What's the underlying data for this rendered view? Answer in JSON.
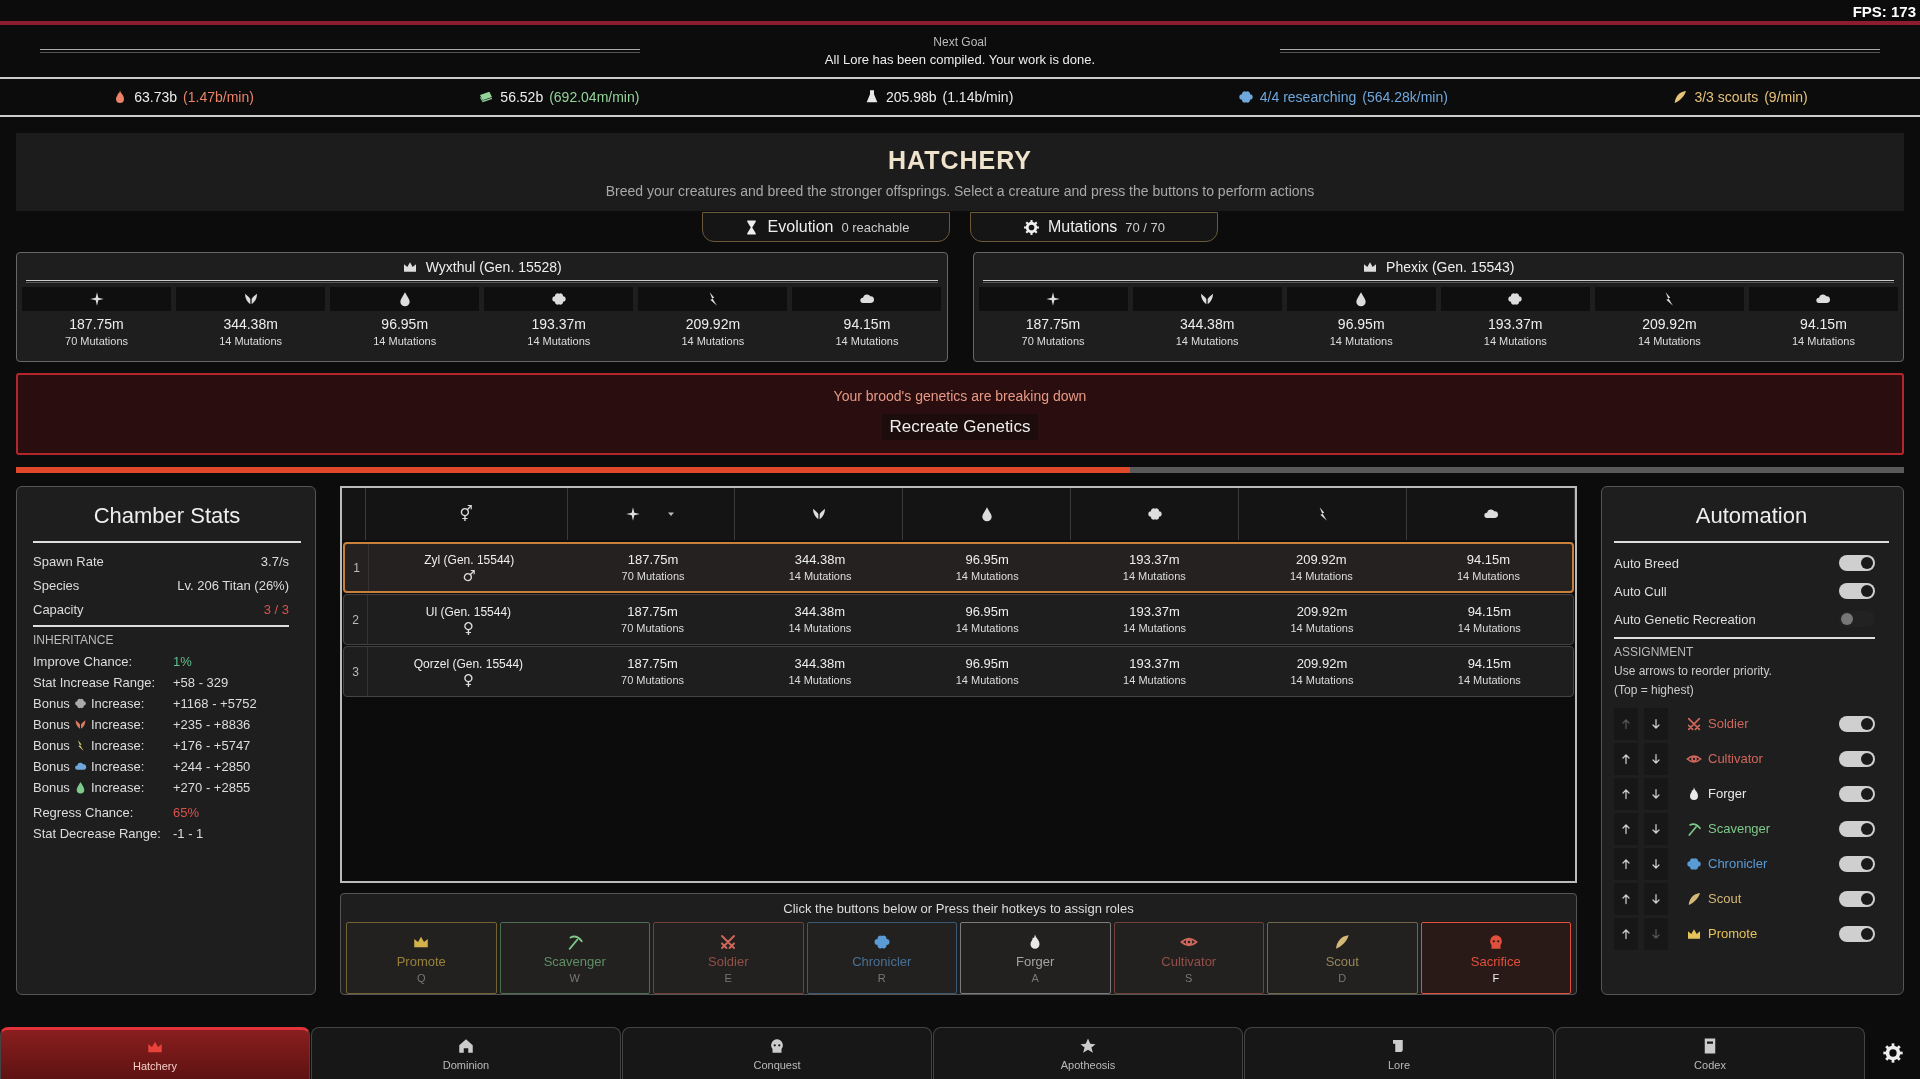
{
  "fps": "FPS: 173",
  "next_goal": {
    "title": "Next Goal",
    "message": "All Lore has been compiled. Your work is done."
  },
  "resources": [
    {
      "value": "63.73b",
      "rate": "(1.47b/min)",
      "color": "#e8836a",
      "tinted": false
    },
    {
      "value": "56.52b",
      "rate": "(692.04m/min)",
      "color": "#93d49a",
      "tinted": false
    },
    {
      "value": "205.98b",
      "rate": "(1.14b/min)",
      "color": "#e8e8e8",
      "tinted": false
    },
    {
      "value": "4/4 researching",
      "rate": "(564.28k/min)",
      "color": "#6fa8dc",
      "tinted": true
    },
    {
      "value": "3/3 scouts",
      "rate": "(9/min)",
      "color": "#e6c27a",
      "tinted": true
    }
  ],
  "hatchery": {
    "title": "HATCHERY",
    "subtitle": "Breed your creatures and breed the stronger offsprings. Select a creature and press the buttons to perform actions",
    "tabs": [
      {
        "kind": "evolution",
        "label": "Evolution",
        "count": "0 reachable"
      },
      {
        "kind": "mutations",
        "label": "Mutations",
        "count": "70 / 70"
      }
    ]
  },
  "parents": [
    {
      "name": "Wyxthul (Gen. 15528)",
      "stats": [
        {
          "value": "187.75m",
          "mutations": "70 Mutations"
        },
        {
          "value": "344.38m",
          "mutations": "14 Mutations"
        },
        {
          "value": "96.95m",
          "mutations": "14 Mutations"
        },
        {
          "value": "193.37m",
          "mutations": "14 Mutations"
        },
        {
          "value": "209.92m",
          "mutations": "14 Mutations"
        },
        {
          "value": "94.15m",
          "mutations": "14 Mutations"
        }
      ]
    },
    {
      "name": "Phexix (Gen. 15543)",
      "stats": [
        {
          "value": "187.75m",
          "mutations": "70 Mutations"
        },
        {
          "value": "344.38m",
          "mutations": "14 Mutations"
        },
        {
          "value": "96.95m",
          "mutations": "14 Mutations"
        },
        {
          "value": "193.37m",
          "mutations": "14 Mutations"
        },
        {
          "value": "209.92m",
          "mutations": "14 Mutations"
        },
        {
          "value": "94.15m",
          "mutations": "14 Mutations"
        }
      ]
    }
  ],
  "warning": {
    "message": "Your brood's genetics are breaking down",
    "button": "Recreate Genetics"
  },
  "brood_progress": {
    "level": 0.59
  },
  "chamber_stats": {
    "title": "Chamber Stats",
    "rows": [
      {
        "label": "Spawn Rate",
        "value": "3.7/s"
      },
      {
        "label": "Species",
        "value": "Lv. 206 Titan (26%)"
      },
      {
        "label": "Capacity",
        "value": "3 / 3",
        "color": "#d9534f"
      }
    ],
    "section": "INHERITANCE",
    "inheritance": [
      {
        "kind": "plain",
        "label": "Improve Chance:",
        "value": "1%",
        "color": "#5fbf8f"
      },
      {
        "kind": "plain",
        "label": "Stat Increase Range:",
        "value": "+58 - 329"
      },
      {
        "kind": "bonus",
        "before": "Bonus",
        "after": "Increase:",
        "value": "+1168 - +5752"
      },
      {
        "kind": "bonus",
        "before": "Bonus",
        "after": "Increase:",
        "value": "+235 - +8836"
      },
      {
        "kind": "bonus",
        "before": "Bonus",
        "after": "Increase:",
        "value": "+176 - +5747"
      },
      {
        "kind": "bonus",
        "before": "Bonus",
        "after": "Increase:",
        "value": "+244 - +2850"
      },
      {
        "kind": "bonus",
        "before": "Bonus",
        "after": "Increase:",
        "value": "+270 - +2855"
      },
      {
        "kind": "plain",
        "label": "Regress Chance:",
        "value": "65%",
        "color": "#d9534f"
      },
      {
        "kind": "plain",
        "label": "Stat Decrease Range:",
        "value": "-1 - 1"
      }
    ]
  },
  "table": {
    "columns": [
      {
        "text": "⚥"
      },
      {
        "sorted": true
      },
      {
        "sorted": false
      },
      {
        "sorted": false
      },
      {
        "sorted": false
      },
      {
        "sorted": false
      },
      {
        "sorted": false
      }
    ],
    "rows": [
      {
        "index": "1",
        "name": "Zyl (Gen. 15544)",
        "sex": "♂",
        "selected": true,
        "stats": [
          {
            "value": "187.75m",
            "mutations": "70 Mutations"
          },
          {
            "value": "344.38m",
            "mutations": "14 Mutations"
          },
          {
            "value": "96.95m",
            "mutations": "14 Mutations"
          },
          {
            "value": "193.37m",
            "mutations": "14 Mutations"
          },
          {
            "value": "209.92m",
            "mutations": "14 Mutations"
          },
          {
            "value": "94.15m",
            "mutations": "14 Mutations"
          }
        ]
      },
      {
        "index": "2",
        "name": "Ul (Gen. 15544)",
        "sex": "♀",
        "selected": false,
        "stats": [
          {
            "value": "187.75m",
            "mutations": "70 Mutations"
          },
          {
            "value": "344.38m",
            "mutations": "14 Mutations"
          },
          {
            "value": "96.95m",
            "mutations": "14 Mutations"
          },
          {
            "value": "193.37m",
            "mutations": "14 Mutations"
          },
          {
            "value": "209.92m",
            "mutations": "14 Mutations"
          },
          {
            "value": "94.15m",
            "mutations": "14 Mutations"
          }
        ]
      },
      {
        "index": "3",
        "name": "Qorzel (Gen. 15544)",
        "sex": "♀",
        "selected": false,
        "stats": [
          {
            "value": "187.75m",
            "mutations": "70 Mutations"
          },
          {
            "value": "344.38m",
            "mutations": "14 Mutations"
          },
          {
            "value": "96.95m",
            "mutations": "14 Mutations"
          },
          {
            "value": "193.37m",
            "mutations": "14 Mutations"
          },
          {
            "value": "209.92m",
            "mutations": "14 Mutations"
          },
          {
            "value": "94.15m",
            "mutations": "14 Mutations"
          }
        ]
      }
    ]
  },
  "role_bar": {
    "caption": "Click the buttons below or Press their hotkeys to assign roles",
    "buttons": [
      {
        "kind": "promote",
        "label": "Promote",
        "hotkey": "Q",
        "color": "#d4b24a",
        "selected": false
      },
      {
        "kind": "scavenger",
        "label": "Scavenger",
        "hotkey": "W",
        "color": "#7fc98a",
        "selected": false
      },
      {
        "kind": "soldier",
        "label": "Soldier",
        "hotkey": "E",
        "color": "#d0675c",
        "selected": false
      },
      {
        "kind": "chronicler",
        "label": "Chronicler",
        "hotkey": "R",
        "color": "#5b9bd5",
        "selected": false
      },
      {
        "kind": "forger",
        "label": "Forger",
        "hotkey": "A",
        "color": "#e8e8e8",
        "selected": false
      },
      {
        "kind": "cultivator",
        "label": "Cultivator",
        "hotkey": "S",
        "color": "#d0675c",
        "selected": false
      },
      {
        "kind": "scout",
        "label": "Scout",
        "hotkey": "D",
        "color": "#d4b878",
        "selected": false
      },
      {
        "kind": "sacrifice",
        "label": "Sacrifice",
        "hotkey": "F",
        "color": "#e0503c",
        "selected": true
      }
    ]
  },
  "automation": {
    "title": "Automation",
    "toggles": [
      {
        "label": "Auto Breed",
        "on": true
      },
      {
        "label": "Auto Cull",
        "on": true
      },
      {
        "label": "Auto Genetic Recreation",
        "on": false
      }
    ],
    "section": "ASSIGNMENT",
    "hint": "Use arrows to reorder priority.",
    "hint_note": "(Top = highest)",
    "assignment": [
      {
        "kind": "soldier",
        "label": "Soldier",
        "color": "#d0675c",
        "on": true,
        "up_disabled": true,
        "down_disabled": false
      },
      {
        "kind": "cultivator",
        "label": "Cultivator",
        "color": "#d0675c",
        "on": true,
        "up_disabled": false,
        "down_disabled": false
      },
      {
        "kind": "forger",
        "label": "Forger",
        "color": "#e8e8e8",
        "on": true,
        "up_disabled": false,
        "down_disabled": false
      },
      {
        "kind": "scavenger",
        "label": "Scavenger",
        "color": "#7fc98a",
        "on": true,
        "up_disabled": false,
        "down_disabled": false
      },
      {
        "kind": "chronicler",
        "label": "Chronicler",
        "color": "#5b9bd5",
        "on": true,
        "up_disabled": false,
        "down_disabled": false
      },
      {
        "kind": "scout",
        "label": "Scout",
        "color": "#d4b878",
        "on": true,
        "up_disabled": false,
        "down_disabled": false
      },
      {
        "kind": "promote",
        "label": "Promote",
        "color": "#e6c25a",
        "on": true,
        "up_disabled": false,
        "down_disabled": true
      }
    ]
  },
  "nav": [
    {
      "label": "Hatchery",
      "selected": true
    },
    {
      "label": "Dominion",
      "selected": false
    },
    {
      "label": "Conquest",
      "selected": false
    },
    {
      "label": "Apotheosis",
      "selected": false
    },
    {
      "label": "Lore",
      "selected": false
    },
    {
      "label": "Codex",
      "selected": false
    }
  ]
}
